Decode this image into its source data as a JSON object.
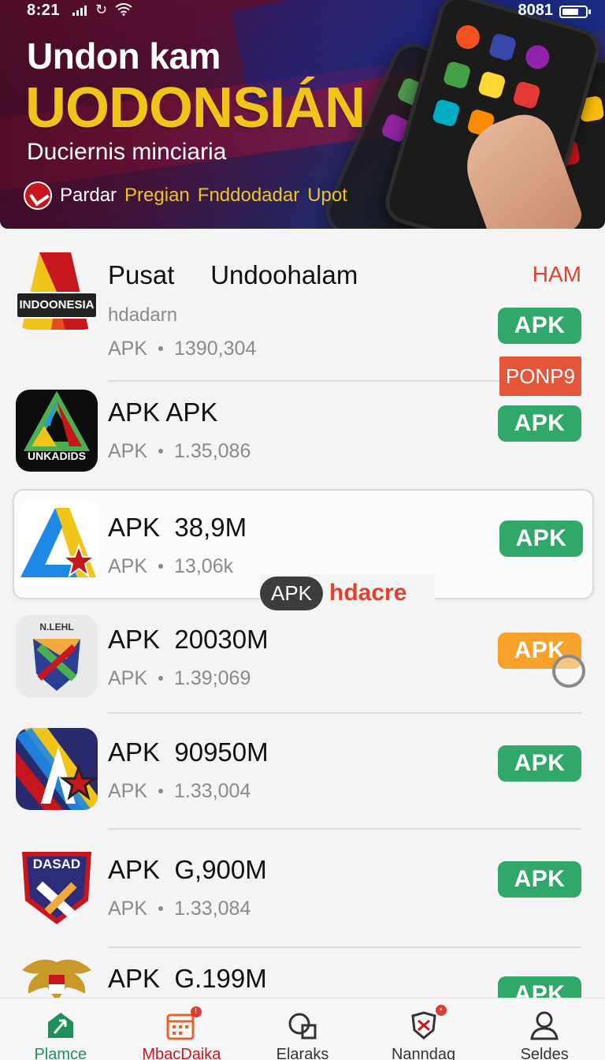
{
  "status_bar": {
    "time": "8:21",
    "right_text": "8081"
  },
  "hero": {
    "title": "Undon kam",
    "headline": "UODONSIÁN",
    "subtitle": "Duciernis minciaria",
    "cta_part1": "Pardar",
    "cta_part2": "Pregian",
    "cta_part3": "Fnddodadar",
    "cta_part4": "Upot"
  },
  "apps": [
    {
      "name": "Pusat     Undoohalam",
      "sub": "hdadarn",
      "type": "APK",
      "count": "1390,304",
      "tag_text": "HAM",
      "button": "APK",
      "icon_label": "INDOONESIA"
    },
    {
      "name": "APK APK",
      "type": "APK",
      "count": "1.35,086",
      "tag_box": "PONP9",
      "button": "APK",
      "icon_label": "UNKADIDS"
    },
    {
      "name": "APK  38,9M",
      "type": "APK",
      "count": "13,06k",
      "button": "APK"
    },
    {
      "name": "APK  20030M",
      "type": "APK",
      "count": "1.39;069",
      "button": "APK",
      "icon_label": "N.LEHL"
    },
    {
      "name": "APK  90950M",
      "type": "APK",
      "count": "1.33,004",
      "button": "APK"
    },
    {
      "name": "APK  G,900M",
      "type": "APK",
      "count": "1.33,084",
      "button": "APK",
      "icon_label": "DASAD"
    },
    {
      "name": "APK  G.199M",
      "button": "APK"
    }
  ],
  "separator": {
    "pill": "APK",
    "text": "hdacre"
  },
  "bottom_nav": [
    {
      "label": "Plamce",
      "icon": "home-icon"
    },
    {
      "label": "MbacDaika",
      "icon": "calendar-icon"
    },
    {
      "label": "Elaraks",
      "icon": "search-icon"
    },
    {
      "label": "Nanndag",
      "icon": "shield-icon"
    },
    {
      "label": "Seldes",
      "icon": "user-icon"
    }
  ],
  "colors": {
    "accent_green": "#2fa86a",
    "accent_orange": "#f6a12a",
    "accent_red": "#e0422d",
    "headline_yellow": "#f0c419"
  }
}
